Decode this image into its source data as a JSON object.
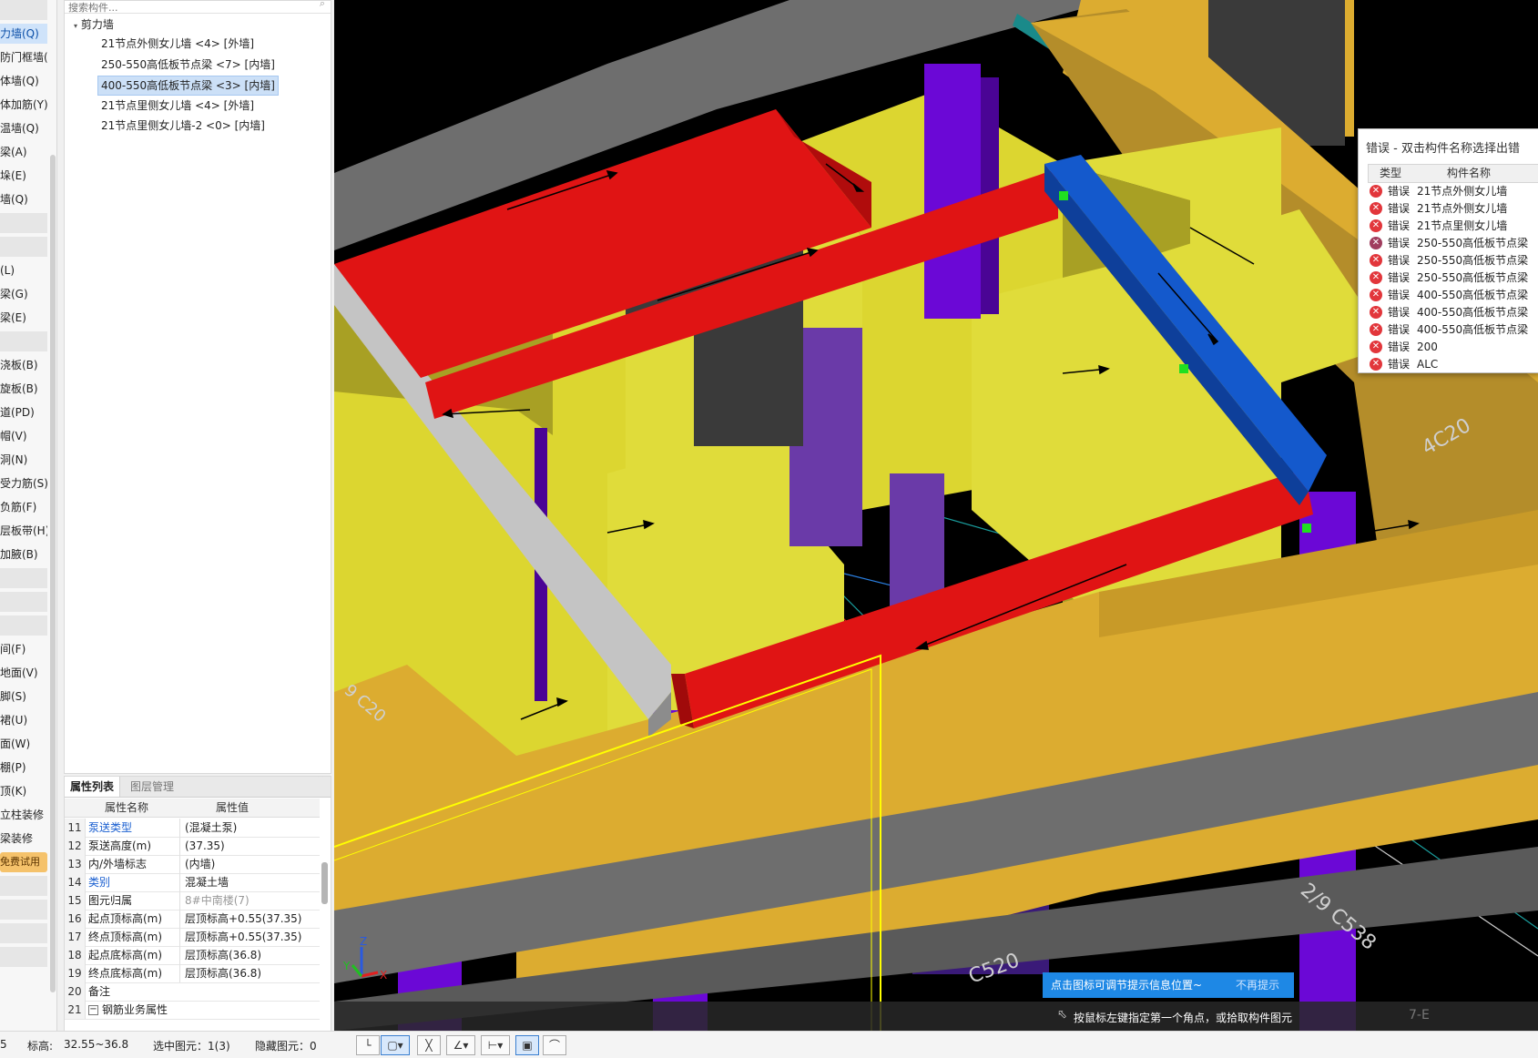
{
  "left_list": {
    "items": [
      {
        "label": "",
        "state": "gap"
      },
      {
        "label": "力墙(Q)",
        "state": "active"
      },
      {
        "label": "防门框墙(",
        "state": ""
      },
      {
        "label": "体墙(Q)",
        "state": ""
      },
      {
        "label": "体加筋(Y)",
        "state": ""
      },
      {
        "label": "温墙(Q)",
        "state": ""
      },
      {
        "label": "梁(A)",
        "state": ""
      },
      {
        "label": "垛(E)",
        "state": ""
      },
      {
        "label": "墙(Q)",
        "state": ""
      },
      {
        "label": "",
        "state": "gap"
      },
      {
        "label": "",
        "state": "gap"
      },
      {
        "label": "(L)",
        "state": ""
      },
      {
        "label": "梁(G)",
        "state": ""
      },
      {
        "label": "梁(E)",
        "state": ""
      },
      {
        "label": "",
        "state": "gap"
      },
      {
        "label": "浇板(B)",
        "state": ""
      },
      {
        "label": "旋板(B)",
        "state": ""
      },
      {
        "label": "道(PD)",
        "state": ""
      },
      {
        "label": "帽(V)",
        "state": ""
      },
      {
        "label": "洞(N)",
        "state": ""
      },
      {
        "label": "受力筋(S)",
        "state": ""
      },
      {
        "label": "负筋(F)",
        "state": ""
      },
      {
        "label": "层板带(H)",
        "state": ""
      },
      {
        "label": "加腋(B)",
        "state": ""
      },
      {
        "label": "",
        "state": "gap"
      },
      {
        "label": "",
        "state": "gap"
      },
      {
        "label": "",
        "state": "gap"
      },
      {
        "label": "间(F)",
        "state": ""
      },
      {
        "label": "地面(V)",
        "state": ""
      },
      {
        "label": "脚(S)",
        "state": ""
      },
      {
        "label": "裙(U)",
        "state": ""
      },
      {
        "label": "面(W)",
        "state": ""
      },
      {
        "label": "棚(P)",
        "state": ""
      },
      {
        "label": "顶(K)",
        "state": ""
      },
      {
        "label": "立柱装修",
        "state": ""
      },
      {
        "label": "梁装修",
        "state": ""
      },
      {
        "label": "免费试用",
        "state": "trial"
      },
      {
        "label": "",
        "state": "gap"
      },
      {
        "label": "",
        "state": "gap"
      },
      {
        "label": "",
        "state": "gap"
      },
      {
        "label": "",
        "state": "gap"
      }
    ]
  },
  "tree": {
    "search_placeholder": "搜索构件...",
    "root_label": "剪力墙",
    "items": [
      {
        "label": "21节点外侧女儿墙 <4> [外墙]",
        "selected": false
      },
      {
        "label": "250-550高低板节点梁 <7> [内墙]",
        "selected": false
      },
      {
        "label": "400-550高低板节点梁 <3> [内墙]",
        "selected": true
      },
      {
        "label": "21节点里侧女儿墙 <4> [外墙]",
        "selected": false
      },
      {
        "label": "21节点里侧女儿墙-2 <0> [内墙]",
        "selected": false
      }
    ]
  },
  "properties": {
    "tabs": [
      "属性列表",
      "图层管理"
    ],
    "col_name": "属性名称",
    "col_value": "属性值",
    "rows": [
      {
        "num": "11",
        "name": "泵送类型",
        "value": "(混凝土泵)",
        "link": true,
        "grey": false
      },
      {
        "num": "12",
        "name": "泵送高度(m)",
        "value": "(37.35)",
        "link": false,
        "grey": false
      },
      {
        "num": "13",
        "name": "内/外墙标志",
        "value": "(内墙)",
        "link": false,
        "grey": false
      },
      {
        "num": "14",
        "name": "类别",
        "value": "混凝土墙",
        "link": true,
        "grey": false
      },
      {
        "num": "15",
        "name": "图元归属",
        "value": "8#中南楼(7)",
        "link": false,
        "grey": true
      },
      {
        "num": "16",
        "name": "起点顶标高(m)",
        "value": "层顶标高+0.55(37.35)",
        "link": false,
        "grey": false
      },
      {
        "num": "17",
        "name": "终点顶标高(m)",
        "value": "层顶标高+0.55(37.35)",
        "link": false,
        "grey": false
      },
      {
        "num": "18",
        "name": "起点底标高(m)",
        "value": "层顶标高(36.8)",
        "link": false,
        "grey": false
      },
      {
        "num": "19",
        "name": "终点底标高(m)",
        "value": "层顶标高(36.8)",
        "link": false,
        "grey": false
      },
      {
        "num": "20",
        "name": "备注",
        "value": "",
        "link": false,
        "grey": false
      },
      {
        "num": "21",
        "name": "钢筋业务属性",
        "value": "",
        "link": false,
        "grey": false,
        "expander": "−"
      }
    ]
  },
  "viewport": {
    "grid_labels": [
      "4C20",
      "C520",
      "2/9 C538",
      "9 C20",
      "7-E"
    ],
    "axis_labels": {
      "x": "X",
      "y": "Y",
      "z": "Z"
    }
  },
  "error_panel": {
    "title": "错误 - 双击构件名称选择出错",
    "col_type": "类型",
    "col_name": "构件名称",
    "rows": [
      {
        "type": "错误",
        "name": "21节点外侧女儿墙",
        "alt": false
      },
      {
        "type": "错误",
        "name": "21节点外侧女儿墙",
        "alt": false
      },
      {
        "type": "错误",
        "name": "21节点里侧女儿墙",
        "alt": false
      },
      {
        "type": "错误",
        "name": "250-550高低板节点梁",
        "alt": true
      },
      {
        "type": "错误",
        "name": "250-550高低板节点梁",
        "alt": false
      },
      {
        "type": "错误",
        "name": "250-550高低板节点梁",
        "alt": false
      },
      {
        "type": "错误",
        "name": "400-550高低板节点梁",
        "alt": false
      },
      {
        "type": "错误",
        "name": "400-550高低板节点梁",
        "alt": false
      },
      {
        "type": "错误",
        "name": "400-550高低板节点梁",
        "alt": false
      },
      {
        "type": "错误",
        "name": "200",
        "alt": false
      },
      {
        "type": "错误",
        "name": "ALC",
        "alt": false
      }
    ]
  },
  "hint": {
    "text": "点击图标可调节提示信息位置~",
    "dismiss": "不再提示"
  },
  "command": {
    "text": "按鼠标左键指定第一个角点，或拾取构件图元",
    "grid_label": "7-E"
  },
  "status": {
    "left_num": "5",
    "elevation_label": "标高:",
    "elevation_value": "32.55~36.8",
    "selected": "选中图元：1(3)",
    "hidden": "隐藏图元：0"
  },
  "colors": {
    "beam_red": "#e01414",
    "beam_blue": "#1459cc",
    "wall_yellow": "#e0dc3a",
    "wall_gold": "#dcac30",
    "column_purple": "#6b08d6",
    "slab_grey": "#6e6e6e"
  }
}
